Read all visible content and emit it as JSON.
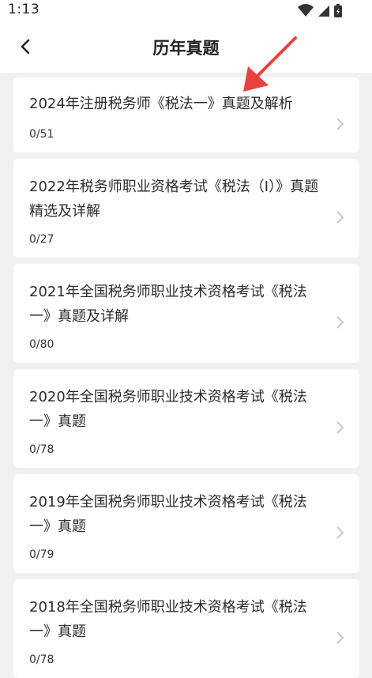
{
  "status": {
    "time": "1:13"
  },
  "header": {
    "title": "历年真题"
  },
  "items": [
    {
      "title": "2024年注册税务师《税法一》真题及解析",
      "count": "0/51"
    },
    {
      "title": "2022年税务师职业资格考试《税法（I）》真题精选及详解",
      "count": "0/27"
    },
    {
      "title": "2021年全国税务师职业技术资格考试《税法一》真题及详解",
      "count": "0/80"
    },
    {
      "title": "2020年全国税务师职业技术资格考试《税法一》真题",
      "count": "0/78"
    },
    {
      "title": "2019年全国税务师职业技术资格考试《税法一》真题",
      "count": "0/79"
    },
    {
      "title": "2018年全国税务师职业技术资格考试《税法一》真题",
      "count": "0/78"
    }
  ],
  "colors": {
    "annotation_arrow": "#e8423f",
    "chevron": "#c8c8c8"
  }
}
